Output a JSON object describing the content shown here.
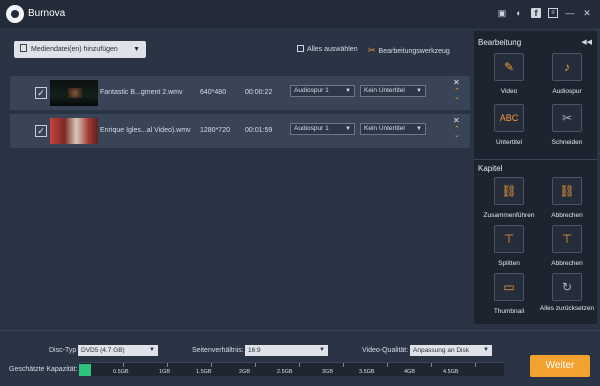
{
  "app": {
    "title": "Burnova"
  },
  "toolbar": {
    "add_files_label": "Mediendatei(en) hinzufügen",
    "select_all_label": "Alles auswählen",
    "edit_tool_label": "Bearbeitungswerkzeug"
  },
  "files": [
    {
      "name": "Fantastic B...gment 2.wmv",
      "resolution": "640*480",
      "duration": "00:00:22",
      "audio": "Audiospur 1",
      "subtitle": "Kein Untertitel"
    },
    {
      "name": "Enrique Igles...al Video).wmv",
      "resolution": "1280*720",
      "duration": "00:01:59",
      "audio": "Audiospur 1",
      "subtitle": "Kein Untertitel"
    }
  ],
  "sidebar": {
    "edit_heading": "Bearbeitung",
    "chapter_heading": "Kapitel",
    "edit_tools": [
      {
        "label": "Video",
        "icon": "magic-wand-icon"
      },
      {
        "label": "Audiospur",
        "icon": "microphone-icon"
      },
      {
        "label": "Untertitel",
        "icon": "abc-icon",
        "glyph": "ABC"
      },
      {
        "label": "Schneiden",
        "icon": "scissors-icon"
      }
    ],
    "chapter_tools": [
      {
        "label": "Zusammenführen",
        "icon": "link-icon"
      },
      {
        "label": "Abbrechen",
        "icon": "unlink-icon"
      },
      {
        "label": "Splitten",
        "icon": "split-icon"
      },
      {
        "label": "Abbrechen",
        "icon": "cancel-split-icon"
      },
      {
        "label": "Thumbnail",
        "icon": "thumbnail-icon"
      },
      {
        "label": "Alles zurücksetzen",
        "icon": "reset-icon"
      }
    ]
  },
  "bottom": {
    "disc_type_label": "Disc-Typ",
    "disc_type_value": "DVD5 (4.7 GB)",
    "aspect_label": "Seitenverhältnis:",
    "aspect_value": "16:9",
    "quality_label": "Video-Qualität:",
    "quality_value": "Anpassung an Disk",
    "capacity_label": "Geschätzte Kapazität:",
    "capacity_ticks": [
      "0.5GB",
      "1GB",
      "1.5GB",
      "2GB",
      "2.5GB",
      "3GB",
      "3.5GB",
      "4GB",
      "4.5GB"
    ],
    "next_label": "Weiter"
  },
  "colors": {
    "accent": "#f3a12f",
    "capacity_fill": "#2ec27e",
    "background": "#2b3445",
    "sidebar": "#1d2430"
  }
}
